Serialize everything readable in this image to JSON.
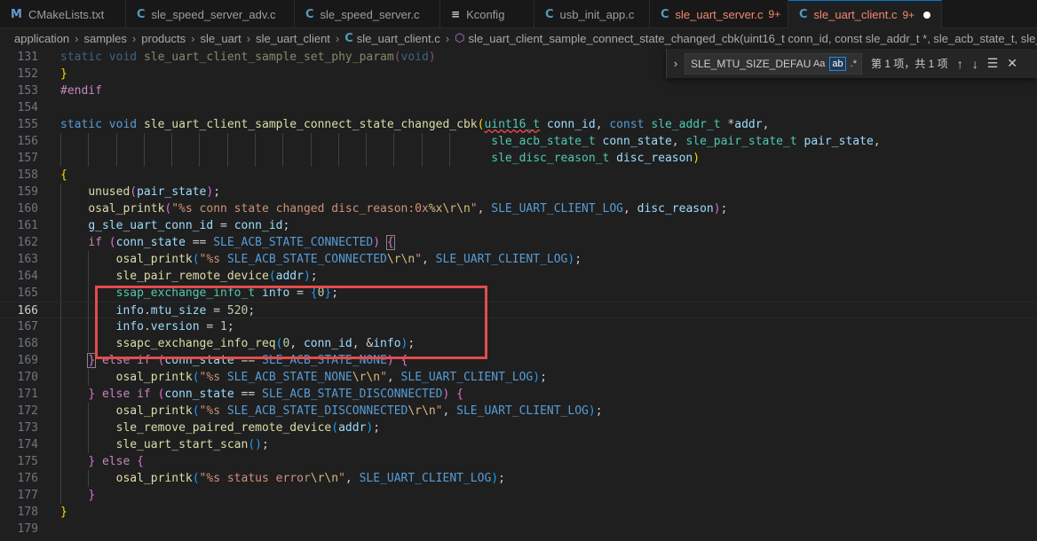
{
  "tabs": [
    {
      "icon": "M",
      "label": "CMakeLists.txt",
      "badge": ""
    },
    {
      "icon": "C",
      "label": "sle_speed_server_adv.c",
      "badge": ""
    },
    {
      "icon": "C",
      "label": "sle_speed_server.c",
      "badge": ""
    },
    {
      "icon": "≡",
      "label": "Kconfig",
      "badge": ""
    },
    {
      "icon": "C",
      "label": "usb_init_app.c",
      "badge": ""
    },
    {
      "icon": "C",
      "label": "sle_uart_server.c",
      "badge": "9+"
    },
    {
      "icon": "C",
      "label": "sle_uart_client.c",
      "badge": "9+"
    }
  ],
  "breadcrumb": {
    "items": [
      "application",
      "samples",
      "products",
      "sle_uart",
      "sle_uart_client"
    ],
    "file": "sle_uart_client.c",
    "symbol": "sle_uart_client_sample_connect_state_changed_cbk(uint16_t conn_id, const sle_addr_t *, sle_acb_state_t, sle_pair_state_t, s"
  },
  "find": {
    "value": "SLE_MTU_SIZE_DEFAULT",
    "match_case": "Aa",
    "whole_word": "ab",
    "regex": ".*",
    "count": "第 1 项，共 1 项"
  },
  "editor": {
    "current_line": "166",
    "lines": [
      {
        "n": "131",
        "html": "<span class=\"dim\"><span class=\"kw\">static</span> <span class=\"kw\">void</span> <span class=\"fn\">sle_uart_client_sample_set_phy_param</span><span class=\"p2\">(</span><span class=\"kw\">void</span><span class=\"p2\">)</span></span>",
        "guides": 0
      },
      {
        "n": "152",
        "html": "<span class=\"p1\">}</span>",
        "guides": 0
      },
      {
        "n": "153",
        "html": "<span class=\"pp\">#endif</span>",
        "guides": 0
      },
      {
        "n": "154",
        "html": "",
        "guides": 0
      },
      {
        "n": "155",
        "html": "<span class=\"kw\">static</span> <span class=\"kw\">void</span> <span class=\"fn\">sle_uart_client_sample_connect_state_changed_cbk</span><span class=\"p1\">(</span><span class=\"ty squig\">uint16_t</span> <span class=\"var\">conn_id</span>, <span class=\"kw\">const</span> <span class=\"ty\">sle_addr_t</span> *<span class=\"var\">addr</span>,",
        "guides": 0
      },
      {
        "n": "156",
        "html": "                                                              <span class=\"ty\">sle_acb_state_t</span> <span class=\"var\">conn_state</span>, <span class=\"ty\">sle_pair_state_t</span> <span class=\"var\">pair_state</span>,",
        "guides": 15
      },
      {
        "n": "157",
        "html": "                                                              <span class=\"ty\">sle_disc_reason_t</span> <span class=\"var\">disc_reason</span><span class=\"p1\">)</span>",
        "guides": 15
      },
      {
        "n": "158",
        "html": "<span class=\"p1\">{</span>",
        "guides": 0
      },
      {
        "n": "159",
        "html": "    <span class=\"fn\">unused</span><span class=\"p2\">(</span><span class=\"var\">pair_state</span><span class=\"p2\">)</span>;",
        "guides": 1
      },
      {
        "n": "160",
        "html": "    <span class=\"fn\">osal_printk</span><span class=\"p2\">(</span><span class=\"str\">\"%s conn state changed disc_reason:0x</span><span class=\"esc\">%x\\r\\n</span><span class=\"str\">\"</span>, <span class=\"mac\">SLE_UART_CLIENT_LOG</span>, <span class=\"var\">disc_reason</span><span class=\"p2\">)</span>;",
        "guides": 1
      },
      {
        "n": "161",
        "html": "    <span class=\"var\">g_sle_uart_conn_id</span> = <span class=\"var\">conn_id</span>;",
        "guides": 1
      },
      {
        "n": "162",
        "html": "    <span class=\"ctl\">if</span> <span class=\"p2\">(</span><span class=\"var\">conn_state</span> == <span class=\"mac\">SLE_ACB_STATE_CONNECTED</span><span class=\"p2\">)</span> <span class=\"p2\" style=\"outline:1px solid #888\">{</span>",
        "guides": 1
      },
      {
        "n": "163",
        "html": "        <span class=\"fn\">osal_printk</span><span class=\"p3\">(</span><span class=\"str\">\"%s </span><span class=\"mac\">SLE_ACB_STATE_CONNECTED</span><span class=\"esc\">\\r\\n</span><span class=\"str\">\"</span>, <span class=\"mac\">SLE_UART_CLIENT_LOG</span><span class=\"p3\">)</span>;",
        "guides": 2
      },
      {
        "n": "164",
        "html": "        <span class=\"fn\">sle_pair_remote_device</span><span class=\"p3\">(</span><span class=\"var\">addr</span><span class=\"p3\">)</span>;",
        "guides": 2
      },
      {
        "n": "165",
        "html": "        <span class=\"ty\">ssap_exchange_info_t</span> <span class=\"var\">info</span> = <span class=\"p3\">{</span><span class=\"num\">0</span><span class=\"p3\">}</span>;",
        "guides": 2
      },
      {
        "n": "166",
        "html": "        <span class=\"var\">info</span>.<span class=\"var\">mtu_size</span> = <span class=\"num\">520</span>;",
        "guides": 2
      },
      {
        "n": "167",
        "html": "        <span class=\"var\">info</span>.<span class=\"var\">version</span> = <span class=\"num\">1</span>;",
        "guides": 2
      },
      {
        "n": "168",
        "html": "        <span class=\"fn\">ssapc_exchange_info_req</span><span class=\"p3\">(</span><span class=\"num\">0</span>, <span class=\"var\">conn_id</span>, &amp;<span class=\"var\">info</span><span class=\"p3\">)</span>;",
        "guides": 2
      },
      {
        "n": "169",
        "html": "    <span class=\"p2\" style=\"outline:1px solid #888\">}</span> <span class=\"ctl\">else if</span> <span class=\"p2\">(</span><span class=\"var\">conn_state</span> == <span class=\"mac\">SLE_ACB_STATE_NONE</span><span class=\"p2\">)</span> <span class=\"p2\">{</span>",
        "guides": 1
      },
      {
        "n": "170",
        "html": "        <span class=\"fn\">osal_printk</span><span class=\"p3\">(</span><span class=\"str\">\"%s </span><span class=\"mac\">SLE_ACB_STATE_NONE</span><span class=\"esc\">\\r\\n</span><span class=\"str\">\"</span>, <span class=\"mac\">SLE_UART_CLIENT_LOG</span><span class=\"p3\">)</span>;",
        "guides": 2
      },
      {
        "n": "171",
        "html": "    <span class=\"p2\">}</span> <span class=\"ctl\">else if</span> <span class=\"p2\">(</span><span class=\"var\">conn_state</span> == <span class=\"mac\">SLE_ACB_STATE_DISCONNECTED</span><span class=\"p2\">)</span> <span class=\"p2\">{</span>",
        "guides": 1
      },
      {
        "n": "172",
        "html": "        <span class=\"fn\">osal_printk</span><span class=\"p3\">(</span><span class=\"str\">\"%s </span><span class=\"mac\">SLE_ACB_STATE_DISCONNECTED</span><span class=\"esc\">\\r\\n</span><span class=\"str\">\"</span>, <span class=\"mac\">SLE_UART_CLIENT_LOG</span><span class=\"p3\">)</span>;",
        "guides": 2
      },
      {
        "n": "173",
        "html": "        <span class=\"fn\">sle_remove_paired_remote_device</span><span class=\"p3\">(</span><span class=\"var\">addr</span><span class=\"p3\">)</span>;",
        "guides": 2
      },
      {
        "n": "174",
        "html": "        <span class=\"fn\">sle_uart_start_scan</span><span class=\"p3\">()</span>;",
        "guides": 2
      },
      {
        "n": "175",
        "html": "    <span class=\"p2\">}</span> <span class=\"ctl\">else</span> <span class=\"p2\">{</span>",
        "guides": 1
      },
      {
        "n": "176",
        "html": "        <span class=\"fn\">osal_printk</span><span class=\"p3\">(</span><span class=\"str\">\"%s status error</span><span class=\"esc\">\\r\\n</span><span class=\"str\">\"</span>, <span class=\"mac\">SLE_UART_CLIENT_LOG</span><span class=\"p3\">)</span>;",
        "guides": 2
      },
      {
        "n": "177",
        "html": "    <span class=\"p2\">}</span>",
        "guides": 1
      },
      {
        "n": "178",
        "html": "<span class=\"p1\">}</span>",
        "guides": 0
      },
      {
        "n": "179",
        "html": "",
        "guides": 0
      }
    ]
  }
}
